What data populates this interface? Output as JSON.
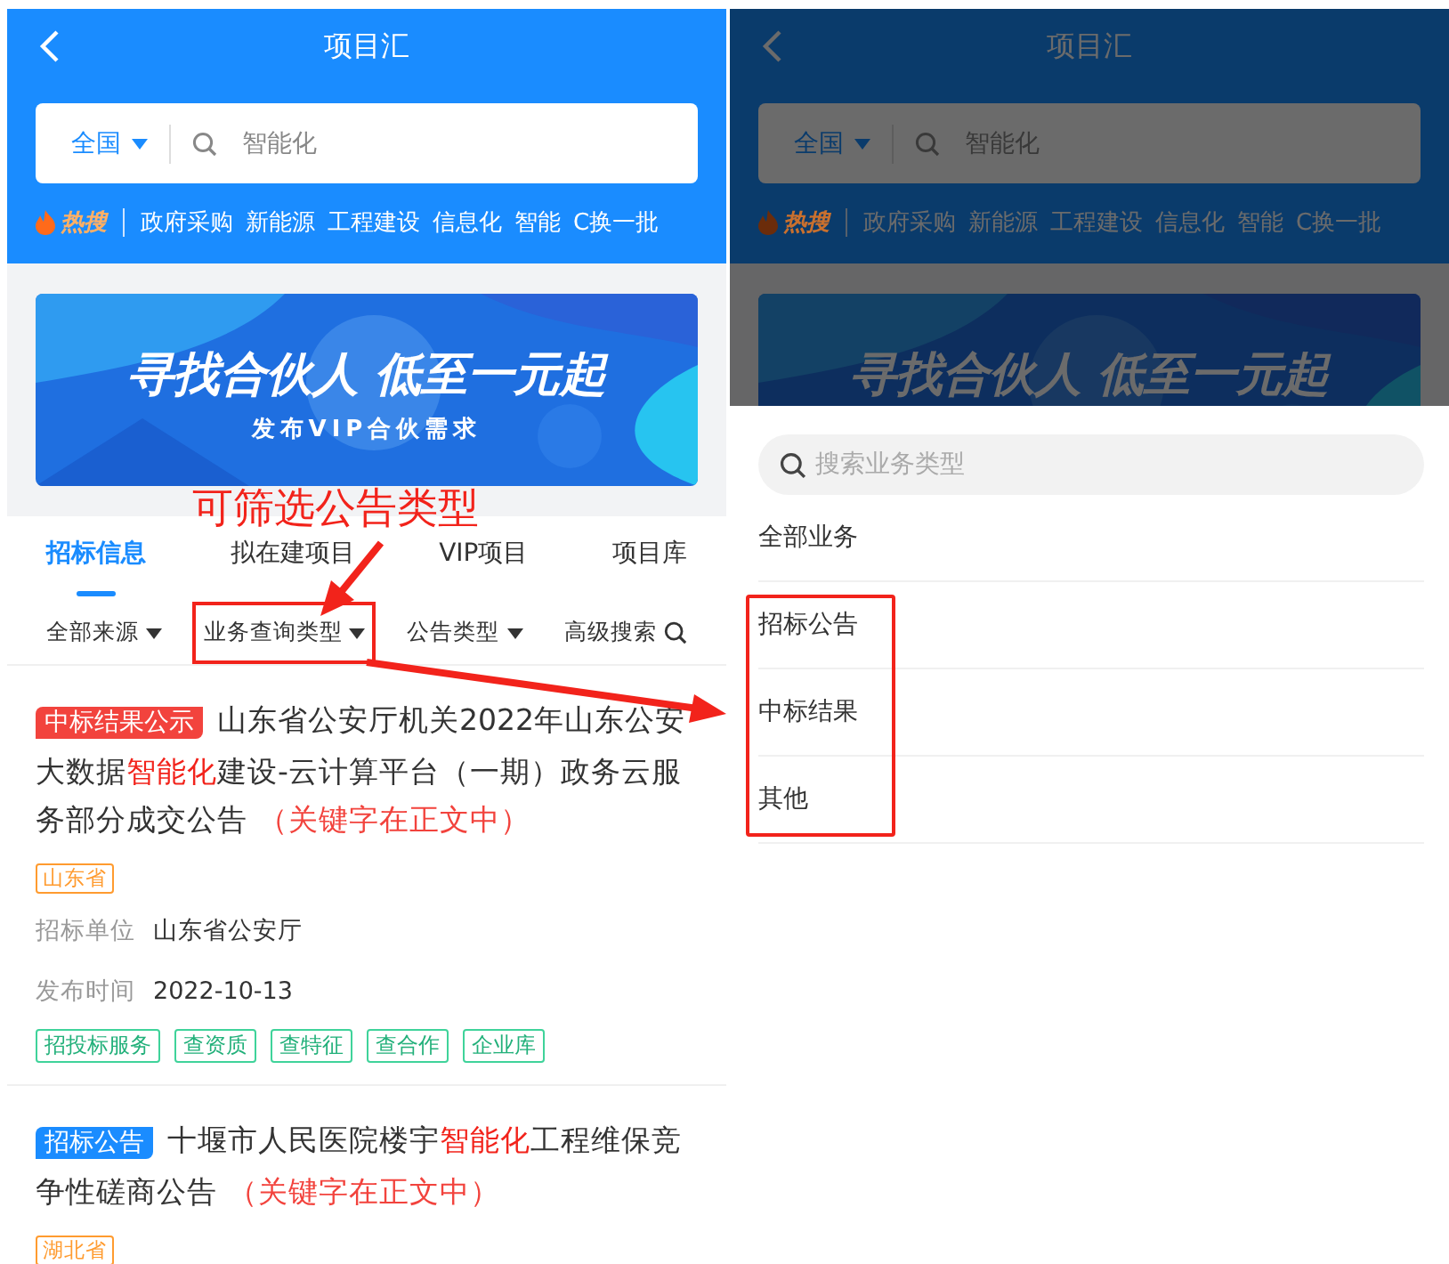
{
  "screens": [
    {
      "header": {
        "title": "项目汇",
        "region": "全国",
        "search_value": "智能化",
        "hot_label": "热搜",
        "hot_terms": [
          "政府采购",
          "新能源",
          "工程建设",
          "信息化",
          "智能"
        ],
        "refresh": "C换一批"
      },
      "banner": {
        "headline": "寻找合伙人 低至一元起",
        "subline": "发布VIP合伙需求"
      },
      "dimmed": false,
      "tabs": [
        {
          "label": "招标信息",
          "selected": true
        },
        {
          "label": "拟在建项目",
          "selected": false
        },
        {
          "label": "VIP项目",
          "selected": false
        },
        {
          "label": "项目库",
          "selected": false
        }
      ],
      "filters": [
        {
          "label": "全部来源",
          "kind": "dropdown",
          "highlighted": false
        },
        {
          "label": "业务查询类型",
          "kind": "dropdown",
          "highlighted": true
        },
        {
          "label": "公告类型",
          "kind": "dropdown",
          "highlighted": false
        },
        {
          "label": "高级搜索",
          "kind": "search",
          "highlighted": false
        }
      ],
      "results": [
        {
          "badge": {
            "text": "中标结果公示",
            "color": "#f2433d"
          },
          "title_parts": [
            {
              "text": "山东省公安厅机关2022年山东公安大数据",
              "highlight": false
            },
            {
              "text": "智能化",
              "highlight": true
            },
            {
              "text": "建设-云计算平台（一期）政务云服务部分成交公告",
              "highlight": false
            }
          ],
          "note": "（关键字在正文中）",
          "region": "山东省",
          "fields": [
            {
              "label": "招标单位",
              "value": "山东省公安厅"
            },
            {
              "label": "发布时间",
              "value": "2022-10-13"
            }
          ],
          "tags": [
            "招投标服务",
            "查资质",
            "查特征",
            "查合作",
            "企业库"
          ]
        },
        {
          "badge": {
            "text": "招标公告",
            "color": "#1a8cff"
          },
          "title_parts": [
            {
              "text": "十堰市人民医院楼宇",
              "highlight": false
            },
            {
              "text": "智能化",
              "highlight": true
            },
            {
              "text": "工程维保竞争性磋商公告",
              "highlight": false
            }
          ],
          "note": "（关键字在正文中）",
          "region": "湖北省"
        }
      ]
    },
    {
      "header": {
        "title": "项目汇",
        "region": "全国",
        "search_value": "智能化",
        "hot_label": "热搜",
        "hot_terms": [
          "政府采购",
          "新能源",
          "工程建设",
          "信息化",
          "智能"
        ],
        "refresh": "C换一批"
      },
      "banner": {
        "headline": "寻找合伙人 低至一元起"
      },
      "dimmed": true,
      "dropdown": {
        "placeholder": "搜索业务类型",
        "options": [
          {
            "label": "全部业务"
          }
        ],
        "highlighted_options": [
          {
            "label": "招标公告"
          },
          {
            "label": "中标结果"
          },
          {
            "label": "其他"
          }
        ]
      }
    }
  ],
  "annotation": {
    "callout": "可筛选公告类型"
  }
}
